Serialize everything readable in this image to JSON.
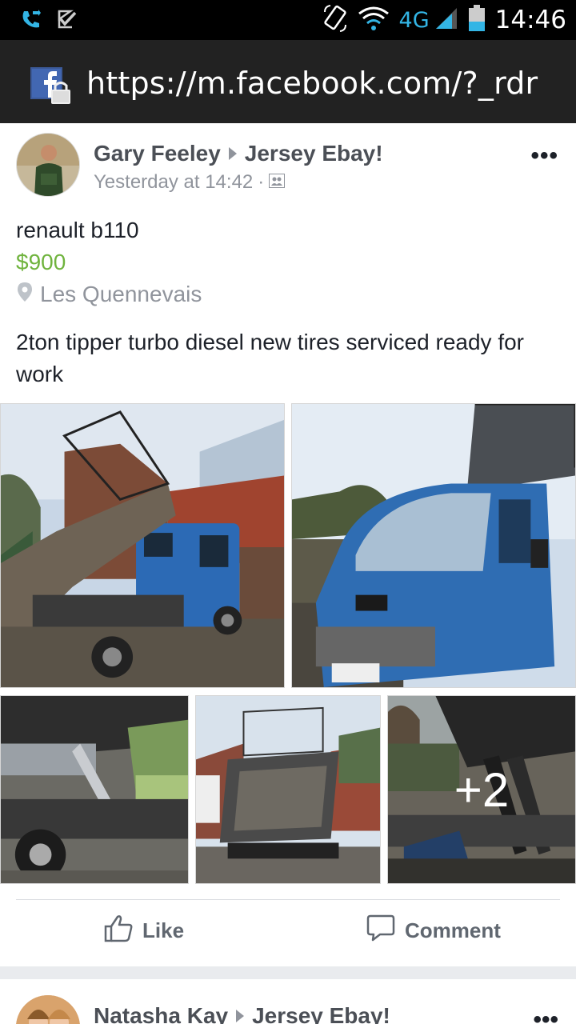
{
  "status_bar": {
    "time": "14:46",
    "network": "4G",
    "icons": [
      "phone-sync-icon",
      "checkbox-notification-icon",
      "rotate-icon",
      "wifi-icon",
      "signal-icon",
      "battery-icon"
    ]
  },
  "browser": {
    "url": "https://m.facebook.com/?_rdr",
    "icons": [
      "facebook-lock-icon"
    ]
  },
  "post": {
    "author": "Gary Feeley",
    "group": "Jersey Ebay!",
    "timestamp": "Yesterday at 14:42",
    "separator": "·",
    "audience_icon": "group-audience-icon",
    "more_icon": "•••",
    "item_title": "renault b110",
    "item_price": "$900",
    "item_location": "Les Quennevais",
    "description": "2ton tipper turbo diesel new tires serviced ready for work",
    "photos": [
      "tipper-truck-raised-photo",
      "truck-cab-front-photo",
      "tipper-underside-photo",
      "tipper-bed-rear-photo",
      "tipper-hydraulics-photo"
    ],
    "extra_photos": "+2",
    "like_label": "Like",
    "comment_label": "Comment"
  },
  "next_post": {
    "author": "Natasha Kay",
    "group": "Jersey Ebay!",
    "more_icon": "•••"
  },
  "colors": {
    "price": "#6fb33d",
    "status_accent": "#33b5e5",
    "link_text": "#4b4f56",
    "meta_text": "#90949c"
  }
}
